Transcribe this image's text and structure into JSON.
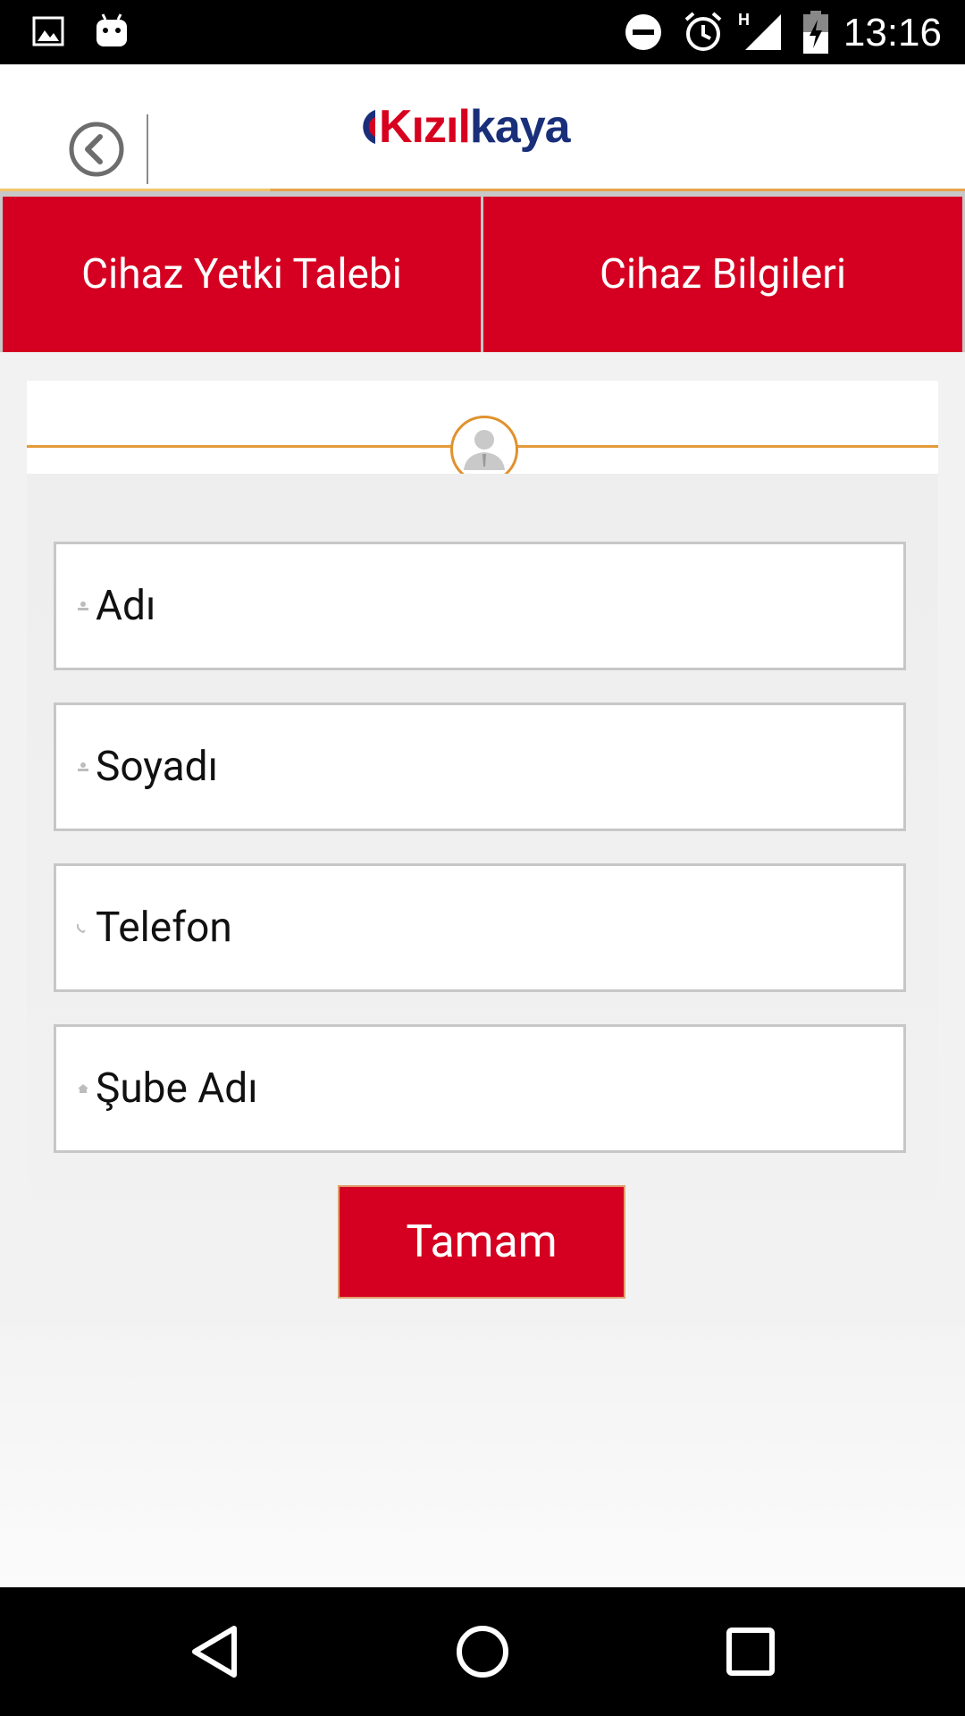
{
  "status_bar": {
    "time": "13:16",
    "icons": [
      "image-icon",
      "android-icon",
      "do-not-disturb-icon",
      "alarm-icon",
      "hspa-icon",
      "signal-icon",
      "battery-charging-icon"
    ]
  },
  "header": {
    "back_icon": "chevron-left-circle-icon",
    "logo": {
      "part1": "Kızıl",
      "part2": "kaya"
    },
    "colors": {
      "brand_red": "#d7001f",
      "brand_blue": "#1a2f7a",
      "accent_orange": "#e39a3a"
    }
  },
  "tabs": [
    {
      "label": "Cihaz Yetki Talebi"
    },
    {
      "label": "Cihaz Bilgileri"
    }
  ],
  "form": {
    "avatar_icon": "user-avatar-icon",
    "fields": [
      {
        "placeholder": "Adı",
        "value": "",
        "icon": "user-icon"
      },
      {
        "placeholder": "Soyadı",
        "value": "",
        "icon": "user-icon"
      },
      {
        "placeholder": "Telefon",
        "value": "",
        "icon": "phone-icon"
      },
      {
        "placeholder": "Şube Adı",
        "value": "",
        "icon": "home-icon"
      }
    ],
    "submit_label": "Tamam"
  },
  "nav_bar": {
    "buttons": [
      "back-triangle-icon",
      "home-circle-icon",
      "recents-square-icon"
    ]
  }
}
